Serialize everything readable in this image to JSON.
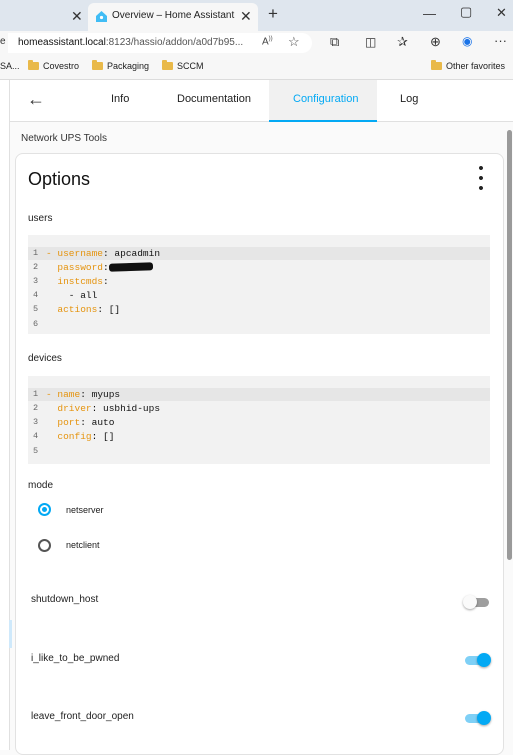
{
  "browser": {
    "prev_tab_close": "✕",
    "active_tab_title": "Overview – Home Assistant",
    "active_tab_close": "✕",
    "new_tab": "+",
    "minimize": "—",
    "maximize": "▢",
    "close": "✕",
    "url_host": "homeassistant.local",
    "url_rest": ":8123/hassio/addon/a0d7b95...",
    "url_left_fragment": "e",
    "favorites": [
      "SA...",
      "Covestro",
      "Packaging",
      "SCCM"
    ],
    "other_favorites": "Other favorites"
  },
  "header": {
    "back": "←",
    "tabs": [
      {
        "label": "Info"
      },
      {
        "label": "Documentation"
      },
      {
        "label": "Configuration"
      },
      {
        "label": "Log"
      }
    ],
    "accent_color": "#03a9f4"
  },
  "page": {
    "section_title": "Network UPS Tools"
  },
  "card": {
    "title": "Options",
    "menu": "⋮",
    "users": {
      "label": "users",
      "lines": [
        {
          "n": "1",
          "key": "- username",
          "val": ": apcadmin"
        },
        {
          "n": "2",
          "key": "  password",
          "val": ":"
        },
        {
          "n": "3",
          "key": "  instcmds",
          "val": ":"
        },
        {
          "n": "4",
          "key": "",
          "val": "    - all"
        },
        {
          "n": "5",
          "key": "  actions",
          "val": ": []"
        },
        {
          "n": "6",
          "key": "",
          "val": ""
        }
      ]
    },
    "devices": {
      "label": "devices",
      "lines": [
        {
          "n": "1",
          "key": "- name",
          "val": ": myups"
        },
        {
          "n": "2",
          "key": "  driver",
          "val": ": usbhid-ups"
        },
        {
          "n": "3",
          "key": "  port",
          "val": ": auto"
        },
        {
          "n": "4",
          "key": "  config",
          "val": ": []"
        },
        {
          "n": "5",
          "key": "",
          "val": ""
        }
      ]
    },
    "mode": {
      "label": "mode",
      "options": [
        {
          "label": "netserver",
          "selected": true
        },
        {
          "label": "netclient",
          "selected": false
        }
      ]
    },
    "switches": [
      {
        "label": "shutdown_host",
        "on": false
      },
      {
        "label": "i_like_to_be_pwned",
        "on": true
      },
      {
        "label": "leave_front_door_open",
        "on": true
      }
    ]
  }
}
